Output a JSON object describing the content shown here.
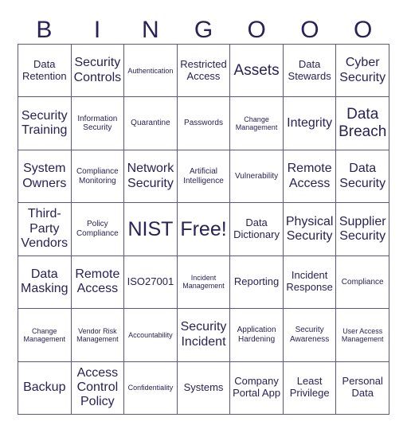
{
  "header": [
    "B",
    "I",
    "N",
    "G",
    "O",
    "O",
    "O"
  ],
  "cells": [
    [
      {
        "text": "Data Retention",
        "size": "md"
      },
      {
        "text": "Security Controls",
        "size": "lg"
      },
      {
        "text": "Authentication",
        "size": "xs"
      },
      {
        "text": "Restricted Access",
        "size": "md"
      },
      {
        "text": "Assets",
        "size": "xl"
      },
      {
        "text": "Data Stewards",
        "size": "md"
      },
      {
        "text": "Cyber Security",
        "size": "lg"
      }
    ],
    [
      {
        "text": "Security Training",
        "size": "lg"
      },
      {
        "text": "Information Security",
        "size": "sm"
      },
      {
        "text": "Quarantine",
        "size": "sm"
      },
      {
        "text": "Passwords",
        "size": "sm"
      },
      {
        "text": "Change Management",
        "size": "xs"
      },
      {
        "text": "Integrity",
        "size": "lg"
      },
      {
        "text": "Data Breach",
        "size": "xl"
      }
    ],
    [
      {
        "text": "System Owners",
        "size": "lg"
      },
      {
        "text": "Compliance Monitoring",
        "size": "sm"
      },
      {
        "text": "Network Security",
        "size": "lg"
      },
      {
        "text": "Artificial Intelligence",
        "size": "sm"
      },
      {
        "text": "Vulnerability",
        "size": "sm"
      },
      {
        "text": "Remote Access",
        "size": "lg"
      },
      {
        "text": "Data Security",
        "size": "lg"
      }
    ],
    [
      {
        "text": "Third-Party Vendors",
        "size": "lg"
      },
      {
        "text": "Policy Compliance",
        "size": "sm"
      },
      {
        "text": "NIST",
        "size": "xxl"
      },
      {
        "text": "Free!",
        "size": "xxl"
      },
      {
        "text": "Data Dictionary",
        "size": "md"
      },
      {
        "text": "Physical Security",
        "size": "lg"
      },
      {
        "text": "Supplier Security",
        "size": "lg"
      }
    ],
    [
      {
        "text": "Data Masking",
        "size": "lg"
      },
      {
        "text": "Remote Access",
        "size": "lg"
      },
      {
        "text": "ISO27001",
        "size": "md"
      },
      {
        "text": "Incident Management",
        "size": "xs"
      },
      {
        "text": "Reporting",
        "size": "md"
      },
      {
        "text": "Incident Response",
        "size": "md"
      },
      {
        "text": "Compliance",
        "size": "sm"
      }
    ],
    [
      {
        "text": "Change Management",
        "size": "xs"
      },
      {
        "text": "Vendor Risk Management",
        "size": "xs"
      },
      {
        "text": "Accountability",
        "size": "xs"
      },
      {
        "text": "Security Incident",
        "size": "lg"
      },
      {
        "text": "Application Hardening",
        "size": "sm"
      },
      {
        "text": "Security Awareness",
        "size": "sm"
      },
      {
        "text": "User Access Management",
        "size": "xs"
      }
    ],
    [
      {
        "text": "Backup",
        "size": "lg"
      },
      {
        "text": "Access Control Policy",
        "size": "lg"
      },
      {
        "text": "Confidentiality",
        "size": "xs"
      },
      {
        "text": "Systems",
        "size": "md"
      },
      {
        "text": "Company Portal App",
        "size": "md"
      },
      {
        "text": "Least Privilege",
        "size": "md"
      },
      {
        "text": "Personal Data",
        "size": "md"
      }
    ]
  ]
}
